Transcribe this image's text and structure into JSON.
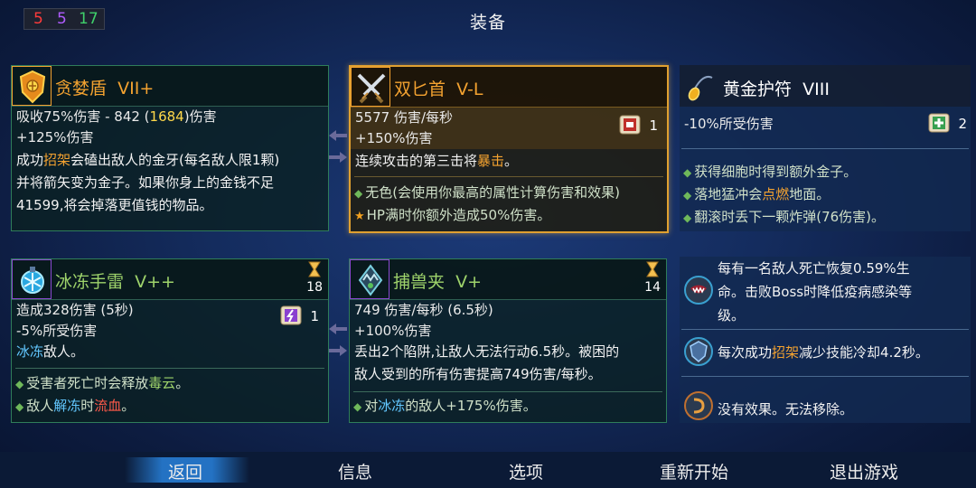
{
  "title": "装备",
  "items": {
    "greed_shield": {
      "name": "贪婪盾",
      "tier": "VII+",
      "stat1": {
        "a": "吸收75%伤害 - 842 (",
        "b": "1684",
        "c": ")伤害"
      },
      "stat2": "+125%伤害",
      "desc": {
        "l1a": "成功",
        "l1b": "招架",
        "l1c": "会磕出敌人的金牙(每名敌人限1颗)",
        "l2": "并将箭矢变为金子。如果你身上的金钱不足",
        "l3": "41599,将会掉落更值钱的物品。"
      },
      "icon": "gold-shield-icon",
      "color": "#f3a230"
    },
    "twin_daggers": {
      "name": "双匕首",
      "tier": "V-L",
      "stat1": "5577 伤害/每秒",
      "stat2": "+150%伤害",
      "scroll_count": "1",
      "desc": {
        "a": "连续攻击的第三击将",
        "b": "暴击",
        "c": "。"
      },
      "bullet1": "无色(会使用你最高的属性计算伤害和效果)",
      "bullet2": "HP满时你额外造成50%伤害。",
      "icon": "crossed-daggers-icon",
      "color": "#f3a230"
    },
    "golden_amulet": {
      "name": "黄金护符",
      "tier": "VIII",
      "stat1": "-10%所受伤害",
      "scroll_count": "2",
      "bullet1": "获得细胞时得到额外金子。",
      "bullet2": {
        "a": "落地猛冲会",
        "b": "点燃",
        "c": "地面。"
      },
      "bullet3": "翻滚时丢下一颗炸弹(76伤害)。",
      "icon": "amulet-icon"
    },
    "ice_grenade": {
      "name": "冰冻手雷",
      "tier": "V++",
      "cooldown": "18",
      "stat1": "造成328伤害 (5秒)",
      "stat2": "-5%所受伤害",
      "scroll_count": "1",
      "desc": {
        "a": "冰冻",
        "b": "敌人。"
      },
      "bullet1": {
        "a": "受害者死亡时会释放",
        "b": "毒云",
        "c": "。"
      },
      "bullet2": {
        "a": "敌人",
        "b": "解冻",
        "c": "时",
        "d": "流血",
        "e": "。"
      },
      "icon": "ice-grenade-icon",
      "color": "#9ed36b"
    },
    "bear_trap": {
      "name": "捕兽夹",
      "tier": "V+",
      "cooldown": "14",
      "stat1": "749 伤害/每秒 (6.5秒)",
      "stat2": "+100%伤害",
      "desc": {
        "l1": "丢出2个陷阱,让敌人无法行动6.5秒。被困的",
        "l2": "敌人受到的所有伤害提高749伤害/每秒。"
      },
      "bullet1": {
        "a": "对",
        "b": "冰冻",
        "c": "的敌人+175%伤害。"
      },
      "icon": "bear-trap-icon",
      "color": "#9ed36b"
    }
  },
  "mutations": [
    {
      "text_l1": "每有一名敌人死亡恢复0.59%生",
      "text_l2": "命。击败Boss时降低疫病感染等",
      "text_l3": "级。",
      "icon": "vampire-mouth-icon"
    },
    {
      "a": "每次成功",
      "b": "招架",
      "c": "减少技能冷却4.2秒。",
      "icon": "parry-mutation-icon"
    },
    {
      "text": "没有效果。无法移除。",
      "icon": "curse-mutation-icon"
    }
  ],
  "scrolls": {
    "brutality": "5",
    "tactics": "5",
    "survival": "17"
  },
  "menu": {
    "back": "返回",
    "info": "信息",
    "options": "选项",
    "restart": "重新开始",
    "quit": "退出游戏"
  },
  "colors": {
    "brutality": "#ff3b3b",
    "tactics": "#b05cff",
    "survival": "#3fcf6a",
    "highlight": "#f3a230",
    "selected": "#2a82dc"
  }
}
